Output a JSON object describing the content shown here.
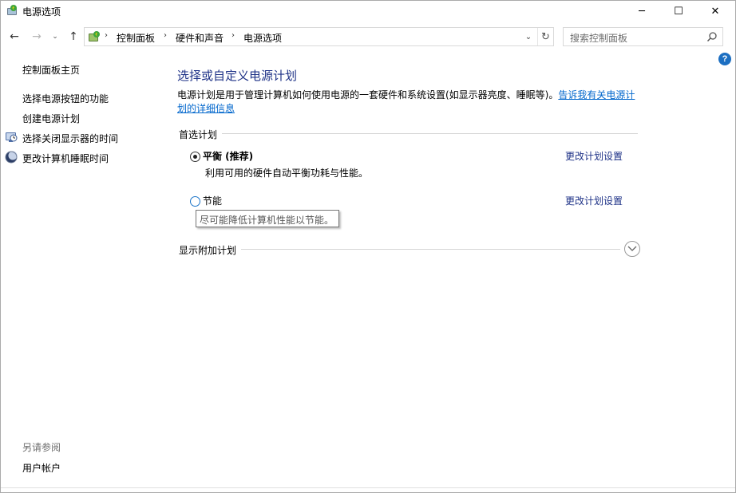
{
  "window": {
    "title": "电源选项",
    "minimize_glyph": "─",
    "maximize_glyph": "☐",
    "close_glyph": "✕"
  },
  "nav": {
    "back_glyph": "←",
    "forward_glyph": "→",
    "recent_glyph": "⌄",
    "up_glyph": "↑",
    "breadcrumbs": [
      "控制面板",
      "硬件和声音",
      "电源选项"
    ],
    "separator": "›",
    "refresh_glyph": "↻",
    "dropdown_glyph": "⌄"
  },
  "search": {
    "placeholder": "搜索控制面板"
  },
  "help": {
    "glyph": "?"
  },
  "sidebar": {
    "home": "控制面板主页",
    "items": [
      {
        "label": "选择电源按钮的功能",
        "icon": ""
      },
      {
        "label": "创建电源计划",
        "icon": ""
      },
      {
        "label": "选择关闭显示器的时间",
        "icon": "monitor-clock-icon"
      },
      {
        "label": "更改计算机睡眠时间",
        "icon": "moon-sleep-icon"
      }
    ],
    "see_also": "另请参阅",
    "see_also_items": [
      "用户帐户"
    ]
  },
  "main": {
    "heading": "选择或自定义电源计划",
    "description": "电源计划是用于管理计算机如何使用电源的一套硬件和系统设置(如显示器亮度、睡眠等)。",
    "description_link": "告诉我有关电源计划的详细信息",
    "preferred_section": "首选计划",
    "plans": [
      {
        "name": "平衡 (推荐)",
        "description": "利用可用的硬件自动平衡功耗与性能。",
        "selected": true,
        "change_link": "更改计划设置"
      },
      {
        "name": "节能",
        "description": "",
        "selected": false,
        "change_link": "更改计划设置"
      }
    ],
    "tooltip": "尽可能降低计算机性能以节能。",
    "additional_section": "显示附加计划"
  },
  "colors": {
    "heading": "#1e3287",
    "link": "#0066cc",
    "accent": "#1a73c8"
  }
}
